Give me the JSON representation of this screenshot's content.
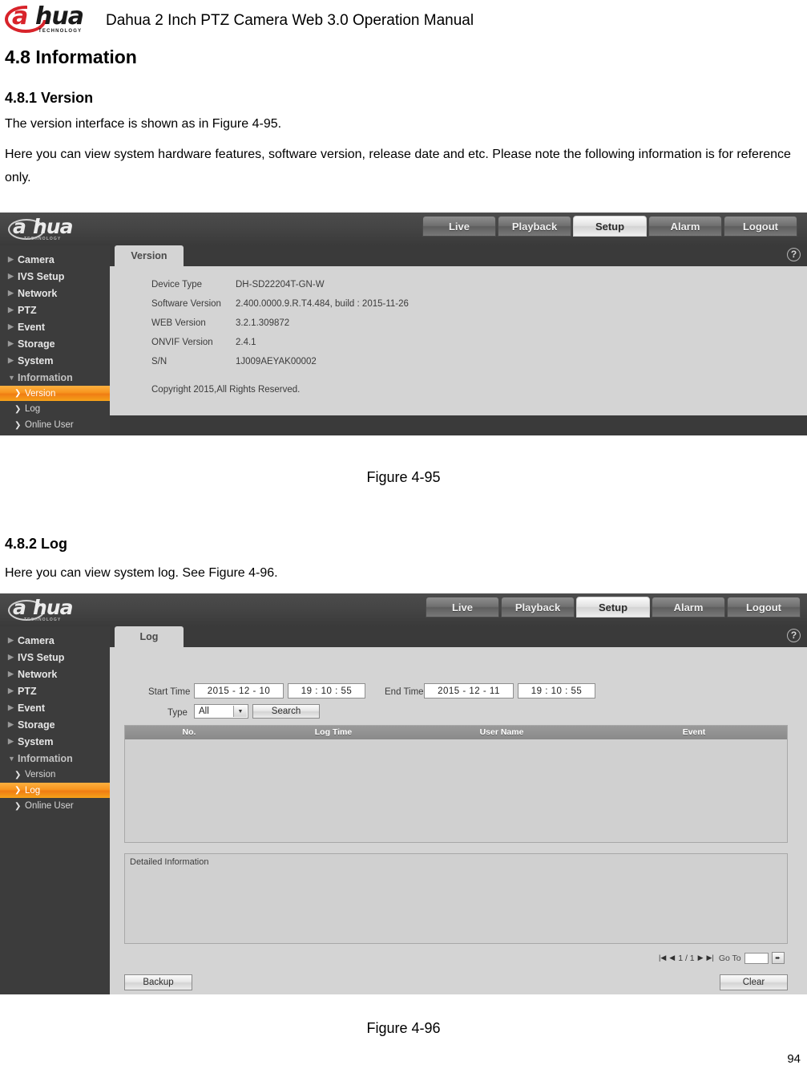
{
  "document": {
    "header_title": "Dahua 2 Inch PTZ Camera Web 3.0 Operation Manual",
    "logo": {
      "letter": "a",
      "word": "hua",
      "tagline": "TECHNOLOGY"
    },
    "section_48": "4.8  Information",
    "section_481": "4.8.1   Version",
    "version_para_1": "The version interface is shown as in Figure 4-95.",
    "version_para_2": "Here you can view system hardware features, software version, release date and etc. Please note the following information is for reference only.",
    "figure_95_caption": "Figure 4-95",
    "section_482": "4.8.2   Log",
    "log_para_1": "Here you can view system log. See Figure 4-96.",
    "figure_96_caption": "Figure 4-96",
    "page_number": "94"
  },
  "ui": {
    "nav_tabs": [
      "Live",
      "Playback",
      "Setup",
      "Alarm",
      "Logout"
    ],
    "active_nav_tab": "Setup",
    "help_icon": "?",
    "menu": [
      {
        "label": "Camera",
        "icon": "triangle-right-icon"
      },
      {
        "label": "IVS Setup",
        "icon": "triangle-right-icon"
      },
      {
        "label": "Network",
        "icon": "triangle-right-icon"
      },
      {
        "label": "PTZ",
        "icon": "triangle-right-icon"
      },
      {
        "label": "Event",
        "icon": "triangle-right-icon"
      },
      {
        "label": "Storage",
        "icon": "triangle-right-icon"
      },
      {
        "label": "System",
        "icon": "triangle-right-icon"
      },
      {
        "label": "Information",
        "icon": "triangle-down-icon"
      }
    ],
    "submenu": [
      {
        "label": "Version",
        "icon": "chevron-right-icon"
      },
      {
        "label": "Log",
        "icon": "chevron-right-icon"
      },
      {
        "label": "Online User",
        "icon": "chevron-right-icon"
      }
    ],
    "accent_color": "#f7941e",
    "panel_bg": "#d4d4d4",
    "chrome_bg": "#3a3a3a"
  },
  "version_screen": {
    "tab_label": "Version",
    "selected_submenu": "Version",
    "rows": [
      {
        "label": "Device Type",
        "value": "DH-SD22204T-GN-W"
      },
      {
        "label": "Software Version",
        "value": "2.400.0000.9.R.T4.484, build : 2015-11-26"
      },
      {
        "label": "WEB Version",
        "value": "3.2.1.309872"
      },
      {
        "label": "ONVIF Version",
        "value": "2.4.1"
      },
      {
        "label": "S/N",
        "value": "1J009AEYAK00002"
      }
    ],
    "copyright": "Copyright 2015,All Rights Reserved."
  },
  "log_screen": {
    "tab_label": "Log",
    "selected_submenu": "Log",
    "start_time_label": "Start Time",
    "start_date_value": "2015  -  12  -  10",
    "start_clock_value": "19  :  10  :  55",
    "end_time_label": "End Time",
    "end_date_value": "2015  -  12  -  11",
    "end_clock_value": "19  :  10  :  55",
    "type_label": "Type",
    "type_value": "All",
    "search_button": "Search",
    "table_headers": [
      "No.",
      "Log Time",
      "User Name",
      "Event"
    ],
    "table_rows": [],
    "detail_label": "Detailed Information",
    "pagination": {
      "first_icon": "|◀",
      "prev_icon": "◀",
      "page_indicator": "1 / 1",
      "next_icon": "▶",
      "last_icon": "▶|",
      "goto_label": "Go To",
      "goto_value": "",
      "go_icon": "➨"
    },
    "backup_button": "Backup",
    "clear_button": "Clear"
  }
}
